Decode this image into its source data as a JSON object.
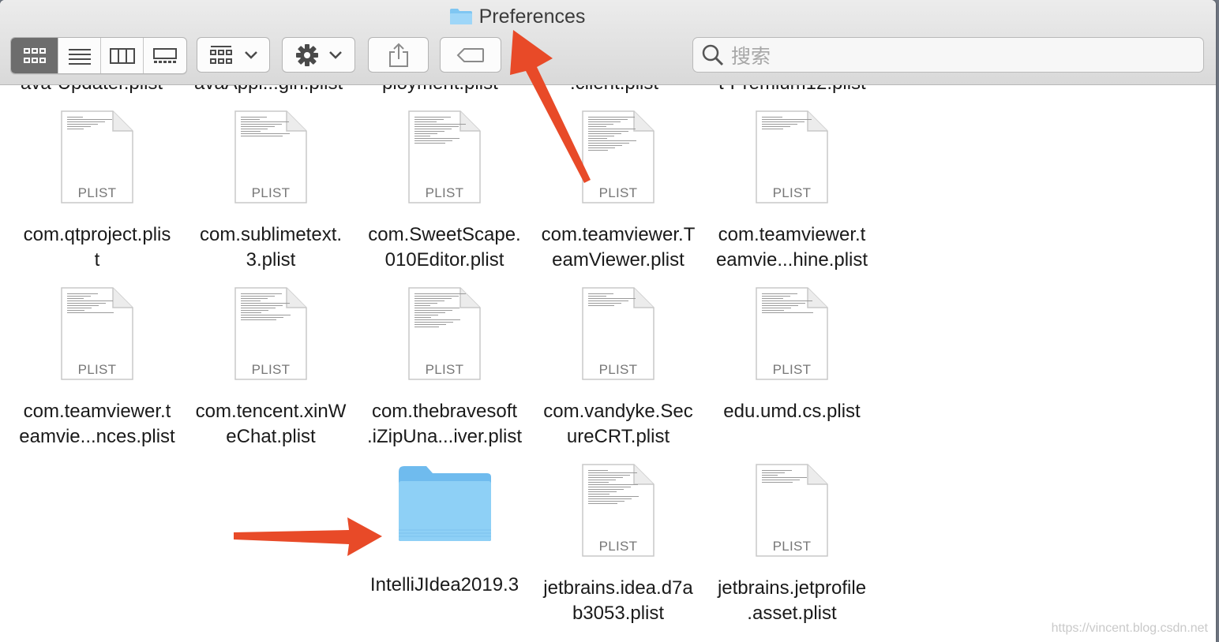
{
  "window": {
    "title": "Preferences",
    "title_icon": "folder-icon"
  },
  "toolbar": {
    "view_modes": [
      {
        "name": "icon-view-icon",
        "active": true
      },
      {
        "name": "list-view-icon",
        "active": false
      },
      {
        "name": "column-view-icon",
        "active": false
      },
      {
        "name": "gallery-view-icon",
        "active": false
      }
    ],
    "group_button_icon": "group-grid-icon",
    "action_button_icon": "gear-icon",
    "share_button_icon": "share-icon",
    "tag_button_icon": "tag-icon"
  },
  "search": {
    "placeholder": "搜索"
  },
  "partial_row": [
    "ava-Updater.plist",
    "avaAppl...gin.plist",
    "ployment.plist",
    ".client.plist",
    "t-Premium12.plist"
  ],
  "files": [
    {
      "ext": "PLIST",
      "line1": "com.qtproject.plis",
      "line2": "t"
    },
    {
      "ext": "PLIST",
      "line1": "com.sublimetext.",
      "line2": "3.plist"
    },
    {
      "ext": "PLIST",
      "line1": "com.SweetScape.",
      "line2": "010Editor.plist"
    },
    {
      "ext": "PLIST",
      "line1": "com.teamviewer.T",
      "line2": "eamViewer.plist"
    },
    {
      "ext": "PLIST",
      "line1": "com.teamviewer.t",
      "line2": "eamvie...hine.plist"
    },
    {
      "ext": "PLIST",
      "line1": "com.teamviewer.t",
      "line2": "eamvie...nces.plist"
    },
    {
      "ext": "PLIST",
      "line1": "com.tencent.xinW",
      "line2": "eChat.plist"
    },
    {
      "ext": "PLIST",
      "line1": "com.thebravesoft",
      "line2": ".iZipUna...iver.plist"
    },
    {
      "ext": "PLIST",
      "line1": "com.vandyke.Sec",
      "line2": "ureCRT.plist"
    },
    {
      "ext": "PLIST",
      "line1": "edu.umd.cs.plist",
      "line2": ""
    },
    {
      "ext": "",
      "line1": "IntelliJIdea2019.3",
      "line2": ""
    },
    {
      "ext": "PLIST",
      "line1": "jetbrains.idea.d7a",
      "line2": "b3053.plist"
    },
    {
      "ext": "PLIST",
      "line1": "jetbrains.jetprofile",
      "line2": ".asset.plist"
    }
  ],
  "watermark": "https://vincent.blog.csdn.net",
  "colors": {
    "folder": "#7fc6f2",
    "arrow": "#e84a28",
    "active_segment": "#6d6d6d"
  }
}
